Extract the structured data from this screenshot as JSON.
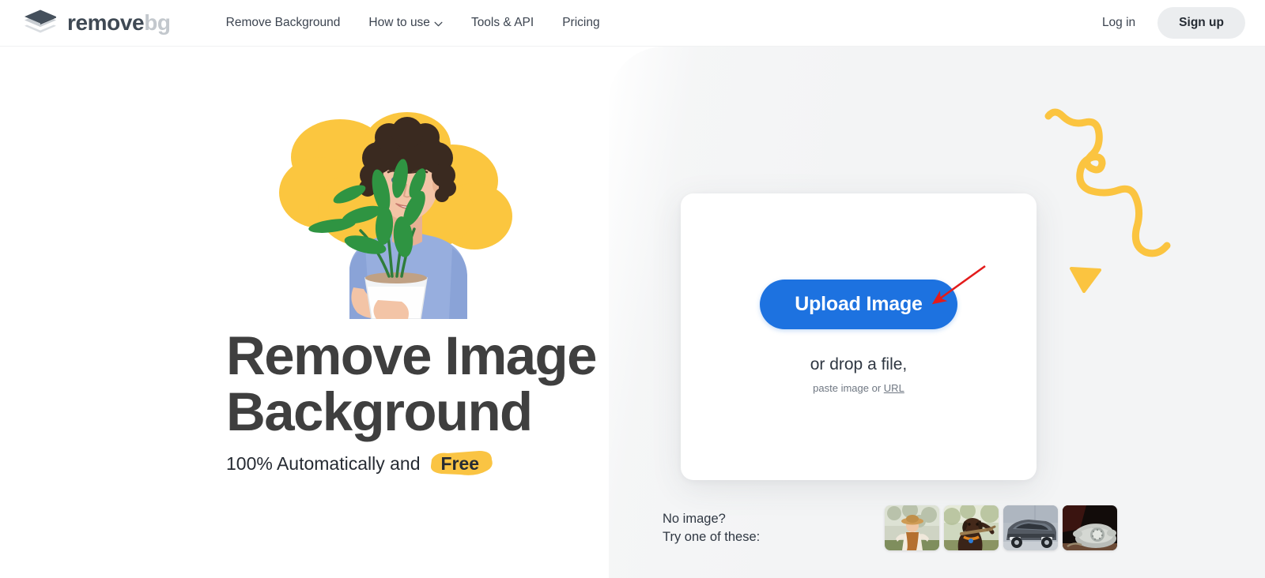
{
  "header": {
    "logo": {
      "icon": "layers-diamond-icon",
      "name_part1": "remove",
      "name_part2": "bg"
    },
    "nav": [
      {
        "label": "Remove Background",
        "has_chevron": false
      },
      {
        "label": "How to use",
        "has_chevron": true,
        "icon": "chevron-down-icon"
      },
      {
        "label": "Tools & API",
        "has_chevron": false
      },
      {
        "label": "Pricing",
        "has_chevron": false
      }
    ],
    "login_label": "Log in",
    "signup_label": "Sign up"
  },
  "hero": {
    "image_alt": "man-with-plant-photo",
    "headline_line1": "Remove Image",
    "headline_line2": "Background",
    "subline_prefix": "100% Automatically and",
    "subline_highlight": "Free"
  },
  "upload": {
    "button_label": "Upload Image",
    "drop_label": "or drop a file,",
    "paste_prefix": "paste image or",
    "url_link_label": "URL"
  },
  "samples": {
    "label_line1": "No image?",
    "label_line2": "Try one of these:",
    "thumbnails": [
      {
        "name": "sample-woman-hat"
      },
      {
        "name": "sample-dog-stick"
      },
      {
        "name": "sample-gray-car"
      },
      {
        "name": "sample-vintage-telephone"
      }
    ]
  },
  "annotation": {
    "arrow": "red-arrow-pointing-to-upload-button"
  },
  "decoration": {
    "squiggle": "yellow-squiggle-line",
    "triangle": "yellow-triangle-down"
  },
  "colors": {
    "accent_blue": "#1d72e0",
    "accent_yellow": "#fac443",
    "logo_dark": "#3f4954",
    "logo_light": "#c3c8cd",
    "heading": "#3f3f3f",
    "panel_bg": "#f3f4f5",
    "annotation_red": "#e31b1b"
  }
}
